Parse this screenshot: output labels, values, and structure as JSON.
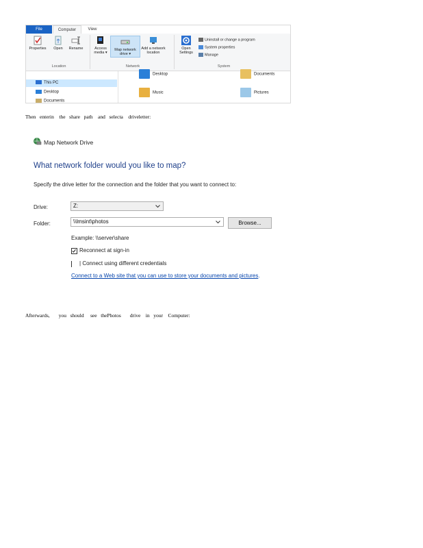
{
  "explorer": {
    "tabs": [
      "File",
      "Computer",
      "View"
    ],
    "location_group": {
      "label": "Location",
      "buttons": [
        "Properties",
        "Open",
        "Rename"
      ]
    },
    "network_group": {
      "label": "Network",
      "buttons": [
        {
          "line1": "Access",
          "line2": "media ▾"
        },
        {
          "line1": "Map network",
          "line2": "drive ▾"
        },
        {
          "line1": "Add a network",
          "line2": "location"
        }
      ]
    },
    "system_group": {
      "label": "System",
      "open_settings_line1": "Open",
      "open_settings_line2": "Settings",
      "items": [
        "Uninstall or change a program",
        "System properties",
        "Manage"
      ]
    },
    "nav": {
      "this_pc": "This PC",
      "desktop": "Desktop",
      "documents": "Documents"
    },
    "folders": {
      "desktop": "Desktop",
      "documents": "Documents",
      "music": "Music",
      "pictures": "Pictures"
    }
  },
  "instruction_1": "Then   enterin    the   share   path    and   selecta    driveletter:",
  "dialog": {
    "title": "Map Network Drive",
    "heading": "What network folder would you like to map?",
    "description": "Specify the drive letter for the connection and the folder that you want to connect to:",
    "drive_label": "Drive:",
    "drive_value": "Z:",
    "folder_label": "Folder:",
    "folder_value": "\\\\lmsint\\photos",
    "browse_label": "Browse...",
    "example": "Example: \\\\server\\share",
    "reconnect_label": "Reconnect at sign-in",
    "reconnect_checked": true,
    "credentials_label": "Connect using different credentials",
    "credentials_checked": false,
    "link_text": "Connect to a Web site that you can use to store your documents and pictures",
    "link_suffix": "."
  },
  "instruction_2": "Afterwards,       you   should     see   thePhotos       drive    in   your    Computer:",
  "colors": {
    "file_tab": "#1a63c4",
    "heading_blue": "#1e3f8a",
    "link_blue": "#0645ad",
    "selection": "#cce8ff"
  }
}
